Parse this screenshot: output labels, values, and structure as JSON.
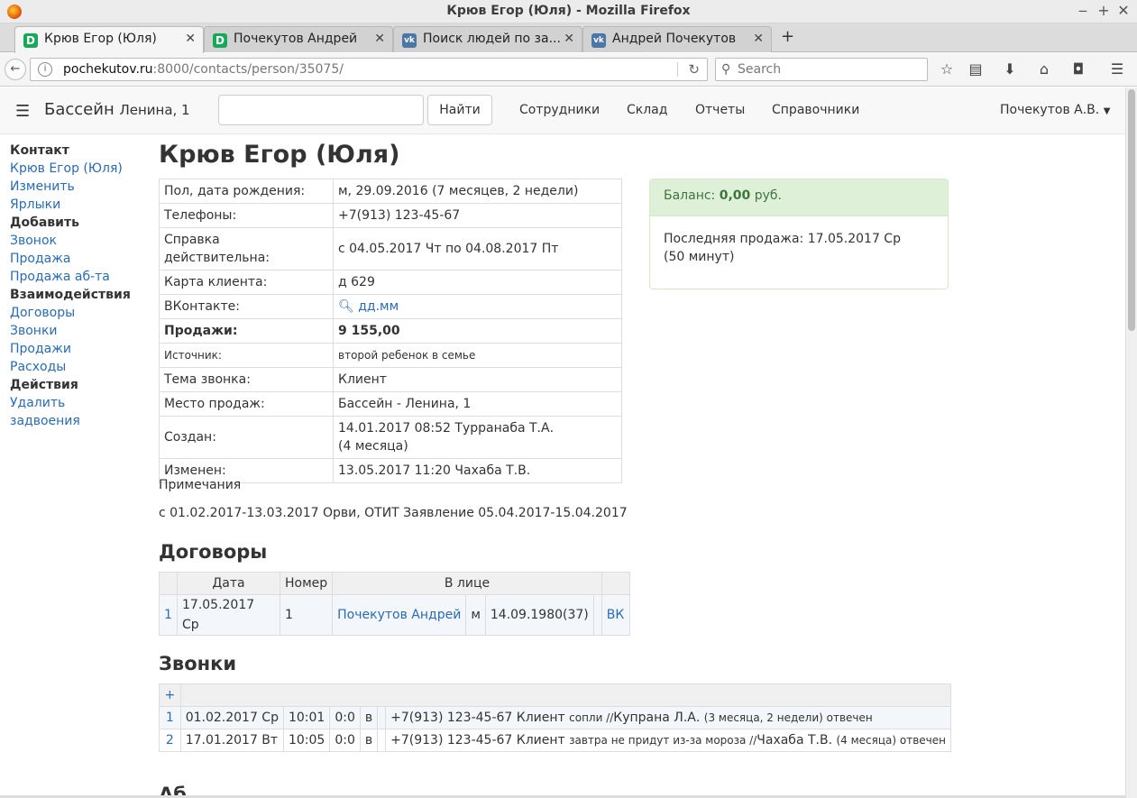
{
  "window": {
    "title": "Крюв Егор (Юля) - Mozilla Firefox"
  },
  "tabs": [
    {
      "label": "Крюв Егор (Юля)",
      "favicon": "D",
      "active": true
    },
    {
      "label": "Почекутов Андрей",
      "favicon": "D",
      "active": false
    },
    {
      "label": "Поиск людей по за...",
      "favicon": "VK",
      "active": false
    },
    {
      "label": "Андрей Почекутов",
      "favicon": "VK",
      "active": false
    }
  ],
  "browser": {
    "url_host": "pochekutov.ru",
    "url_path": ":8000/contacts/person/35075/",
    "search_placeholder": "Search"
  },
  "site": {
    "brand": "Бассейн",
    "brand_sub": "Ленина, 1",
    "find_label": "Найти",
    "menu": [
      "Сотрудники",
      "Склад",
      "Отчеты",
      "Справочники"
    ],
    "user": "Почекутов А.В."
  },
  "sidebar": {
    "contact_hd": "Контакт",
    "contact_name": "Крюв Егор (Юля)",
    "edit": "Изменить",
    "labels": "Ярлыки",
    "add_hd": "Добавить",
    "call": "Звонок",
    "sale": "Продажа",
    "sale_sub": "Продажа аб-та",
    "interactions_hd": "Взаимодействия",
    "contracts": "Договоры",
    "calls": "Звонки",
    "sales": "Продажи",
    "expenses": "Расходы",
    "actions_hd": "Действия",
    "delete": "Удалить",
    "dups": "задвоения"
  },
  "person": {
    "name": "Крюв Егор (Юля)",
    "info": [
      {
        "key": "Пол, дата рождения:",
        "value": "м, 29.09.2016 (7 месяцев, 2 недели)"
      },
      {
        "key": "Телефоны:",
        "value": "+7(913) 123-45-67"
      },
      {
        "key": "Справка действительна:",
        "value": "с 04.05.2017 Чт по 04.08.2017 Пт"
      },
      {
        "key": "Карта клиента:",
        "value": "д 629"
      },
      {
        "key": "ВКонтакте:",
        "value": "дд.мм"
      },
      {
        "key": "Продажи",
        "value": "9 155,00"
      },
      {
        "key": "Источник:",
        "value": "второй ребенок в семье"
      },
      {
        "key": "Тема звонка:",
        "value": "Клиент"
      },
      {
        "key": "Место продаж:",
        "value": "Бассейн - Ленина, 1"
      },
      {
        "key": "Создан:",
        "value": "14.01.2017 08:52 Турранаба Т.А.",
        "value2": "(4 месяца)"
      },
      {
        "key": "Изменен:",
        "value": "13.05.2017 11:20 Чахаба Т.В."
      }
    ]
  },
  "balance": {
    "label": "Баланс:",
    "amount": "0,00",
    "currency": "руб.",
    "last_sale": "Последняя продажа: 17.05.2017 Ср",
    "last_sale_ago": "(50 минут)"
  },
  "notes": {
    "header": "Примечания",
    "text": "с 01.02.2017-13.03.2017 Орви, ОТИТ Заявление 05.04.2017-15.04.2017"
  },
  "contracts": {
    "title": "Договоры",
    "headers": [
      "Дата",
      "Номер",
      "В лице"
    ],
    "rows": [
      {
        "n": "1",
        "date": "17.05.2017 Ср",
        "number": "1",
        "person": "Почекутов Андрей",
        "sex": "м",
        "birth": "14.09.1980(37)",
        "vk": "ВК"
      }
    ]
  },
  "calls": {
    "title": "Звонки",
    "add": "+",
    "rows": [
      {
        "n": "1",
        "date": "01.02.2017 Ср",
        "time": "10:01",
        "dur": "0:0",
        "dir": "в",
        "phone": "+7(913) 123-45-67 Клиент",
        "note": "сопли //",
        "staff": "Купрана Л.А.",
        "ago": "(3 месяца, 2 недели) отвечен"
      },
      {
        "n": "2",
        "date": "17.01.2017 Вт",
        "time": "10:05",
        "dur": "0:0",
        "dir": "в",
        "phone": "+7(913) 123-45-67 Клиент",
        "note": "завтра не придут из-за мороза //",
        "staff": "Чахаба Т.В.",
        "ago": "(4 месяца) отвечен"
      }
    ]
  },
  "cut_heading": "Аб"
}
